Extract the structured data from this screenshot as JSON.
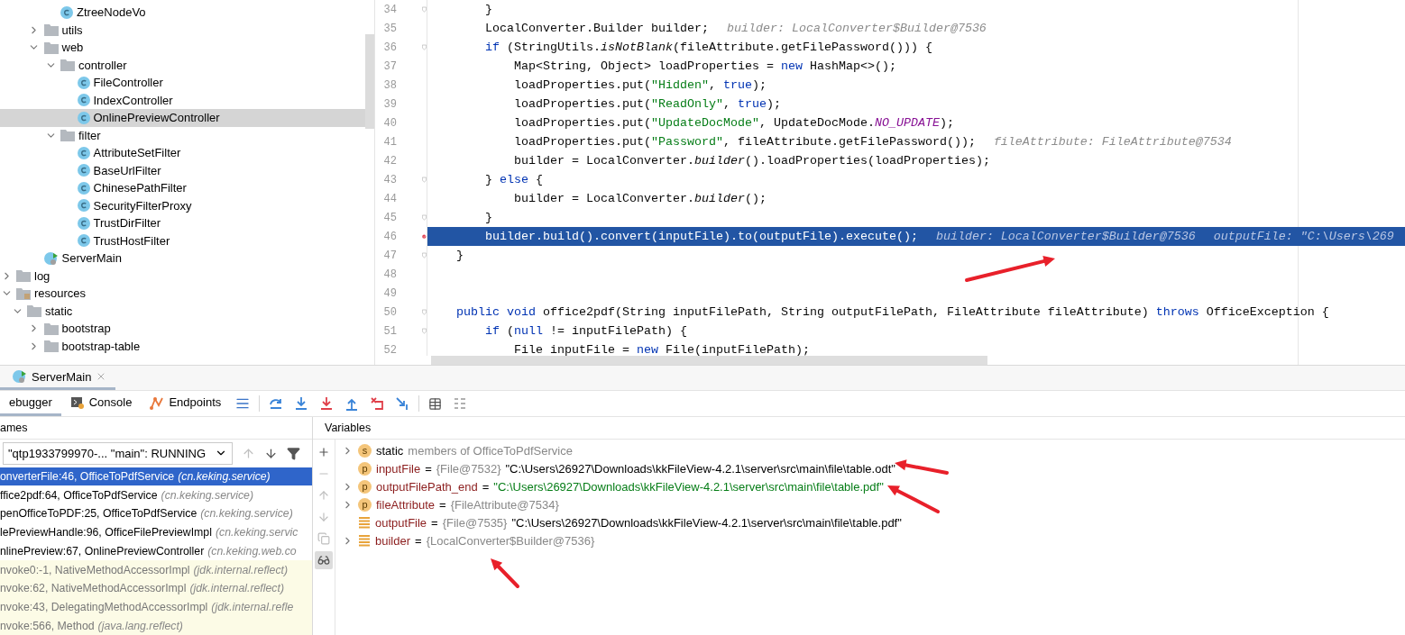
{
  "project_tree": {
    "items": [
      {
        "children": [
          {
            "children": [
              {
                "children": [
                  {
                    "label": "ZtreeNodeVo",
                    "kind": "class",
                    "selected": false
                  }
                ]
              },
              {
                "label": "utils",
                "kind": "folder",
                "expanded": false,
                "selected": false
              },
              {
                "label": "web",
                "kind": "folder",
                "expanded": true,
                "selected": false,
                "children": [
                  {
                    "label": "controller",
                    "kind": "folder",
                    "expanded": true,
                    "selected": false,
                    "children": [
                      {
                        "label": "FileController",
                        "kind": "class",
                        "selected": false
                      },
                      {
                        "label": "IndexController",
                        "kind": "class",
                        "selected": false
                      },
                      {
                        "label": "OnlinePreviewController",
                        "kind": "class",
                        "selected": true
                      }
                    ]
                  },
                  {
                    "label": "filter",
                    "kind": "folder",
                    "expanded": true,
                    "selected": false,
                    "children": [
                      {
                        "label": "AttributeSetFilter",
                        "kind": "class",
                        "selected": false
                      },
                      {
                        "label": "BaseUrlFilter",
                        "kind": "class",
                        "selected": false
                      },
                      {
                        "label": "ChinesePathFilter",
                        "kind": "class",
                        "selected": false
                      },
                      {
                        "label": "SecurityFilterProxy",
                        "kind": "class",
                        "selected": false
                      },
                      {
                        "label": "TrustDirFilter",
                        "kind": "class",
                        "selected": false
                      },
                      {
                        "label": "TrustHostFilter",
                        "kind": "class",
                        "selected": false
                      }
                    ]
                  }
                ]
              },
              {
                "label": "ServerMain",
                "kind": "main",
                "selected": false
              }
            ]
          }
        ]
      },
      {
        "label": "log",
        "kind": "folder",
        "expanded": false,
        "selected": false
      },
      {
        "label": "resources",
        "kind": "resources",
        "expanded": true,
        "selected": false,
        "children": [
          {
            "label": "static",
            "kind": "folder",
            "expanded": true,
            "selected": false,
            "children": [
              {
                "label": "bootstrap",
                "kind": "folder",
                "expanded": false,
                "selected": false
              },
              {
                "label": "bootstrap-table",
                "kind": "folder",
                "expanded": false,
                "selected": false
              }
            ]
          }
        ]
      }
    ]
  },
  "editor": {
    "lines": [
      {
        "number": "34",
        "fold": true,
        "breakpoint": false,
        "selected": false,
        "segments": [
          {
            "kind": "plain",
            "text": "        }"
          }
        ]
      },
      {
        "number": "35",
        "fold": false,
        "breakpoint": false,
        "selected": false,
        "segments": [
          {
            "kind": "plain",
            "text": "        LocalConverter.Builder builder;"
          },
          {
            "kind": "hint",
            "text": "builder: LocalConverter$Builder@7536"
          }
        ]
      },
      {
        "number": "36",
        "fold": true,
        "breakpoint": false,
        "selected": false,
        "segments": [
          {
            "kind": "keyword",
            "text": "        if"
          },
          {
            "kind": "plain",
            "text": " (StringUtils."
          },
          {
            "kind": "italic",
            "text": "isNotBlank"
          },
          {
            "kind": "plain",
            "text": "(fileAttribute.getFilePassword())) {"
          }
        ]
      },
      {
        "number": "37",
        "fold": false,
        "breakpoint": false,
        "selected": false,
        "segments": [
          {
            "kind": "plain",
            "text": "            Map<String, Object> loadProperties = "
          },
          {
            "kind": "keyword",
            "text": "new"
          },
          {
            "kind": "plain",
            "text": " HashMap<>();"
          }
        ]
      },
      {
        "number": "38",
        "fold": false,
        "breakpoint": false,
        "selected": false,
        "segments": [
          {
            "kind": "plain",
            "text": "            loadProperties.put("
          },
          {
            "kind": "string",
            "text": "\"Hidden\""
          },
          {
            "kind": "plain",
            "text": ", "
          },
          {
            "kind": "keyword",
            "text": "true"
          },
          {
            "kind": "plain",
            "text": ");"
          }
        ]
      },
      {
        "number": "39",
        "fold": false,
        "breakpoint": false,
        "selected": false,
        "segments": [
          {
            "kind": "plain",
            "text": "            loadProperties.put("
          },
          {
            "kind": "string",
            "text": "\"ReadOnly\""
          },
          {
            "kind": "plain",
            "text": ", "
          },
          {
            "kind": "keyword",
            "text": "true"
          },
          {
            "kind": "plain",
            "text": ");"
          }
        ]
      },
      {
        "number": "40",
        "fold": false,
        "breakpoint": false,
        "selected": false,
        "segments": [
          {
            "kind": "plain",
            "text": "            loadProperties.put("
          },
          {
            "kind": "string",
            "text": "\"UpdateDocMode\""
          },
          {
            "kind": "plain",
            "text": ", UpdateDocMode."
          },
          {
            "kind": "constant",
            "text": "NO_UPDATE"
          },
          {
            "kind": "plain",
            "text": ");"
          }
        ]
      },
      {
        "number": "41",
        "fold": false,
        "breakpoint": false,
        "selected": false,
        "segments": [
          {
            "kind": "plain",
            "text": "            loadProperties.put("
          },
          {
            "kind": "string",
            "text": "\"Password\""
          },
          {
            "kind": "plain",
            "text": ", fileAttribute.getFilePassword());"
          },
          {
            "kind": "hint",
            "text": "fileAttribute: FileAttribute@7534"
          }
        ]
      },
      {
        "number": "42",
        "fold": false,
        "breakpoint": false,
        "selected": false,
        "segments": [
          {
            "kind": "plain",
            "text": "            builder = LocalConverter."
          },
          {
            "kind": "italic",
            "text": "builder"
          },
          {
            "kind": "plain",
            "text": "().loadProperties(loadProperties);"
          }
        ]
      },
      {
        "number": "43",
        "fold": true,
        "breakpoint": false,
        "selected": false,
        "segments": [
          {
            "kind": "plain",
            "text": "        } "
          },
          {
            "kind": "keyword",
            "text": "else"
          },
          {
            "kind": "plain",
            "text": " {"
          }
        ]
      },
      {
        "number": "44",
        "fold": false,
        "breakpoint": false,
        "selected": false,
        "segments": [
          {
            "kind": "plain",
            "text": "            builder = LocalConverter."
          },
          {
            "kind": "italic",
            "text": "builder"
          },
          {
            "kind": "plain",
            "text": "();"
          }
        ]
      },
      {
        "number": "45",
        "fold": true,
        "breakpoint": false,
        "selected": false,
        "segments": [
          {
            "kind": "plain",
            "text": "        }"
          }
        ]
      },
      {
        "number": "46",
        "fold": false,
        "breakpoint": true,
        "selected": true,
        "segments": [
          {
            "kind": "plain",
            "text": "        builder.build().convert(inputFile).to(outputFile).execute();"
          },
          {
            "kind": "hint",
            "text": "builder: LocalConverter$Builder@7536"
          },
          {
            "kind": "hint",
            "text": "outputFile: \"C:\\Users\\269"
          }
        ]
      },
      {
        "number": "47",
        "fold": true,
        "breakpoint": false,
        "selected": false,
        "segments": [
          {
            "kind": "plain",
            "text": "    }"
          }
        ]
      },
      {
        "number": "48",
        "fold": false,
        "breakpoint": false,
        "selected": false
      },
      {
        "number": "49",
        "fold": false,
        "breakpoint": false,
        "selected": false
      },
      {
        "number": "50",
        "fold": true,
        "breakpoint": false,
        "selected": false,
        "segments": [
          {
            "kind": "keyword",
            "text": "    public void"
          },
          {
            "kind": "plain",
            "text": " office2pdf(String inputFilePath, String outputFilePath, FileAttribute fileAttribute) "
          },
          {
            "kind": "keyword",
            "text": "throws"
          },
          {
            "kind": "plain",
            "text": " OfficeException {"
          }
        ]
      },
      {
        "number": "51",
        "fold": true,
        "breakpoint": false,
        "selected": false,
        "segments": [
          {
            "kind": "keyword",
            "text": "        if"
          },
          {
            "kind": "plain",
            "text": " ("
          },
          {
            "kind": "keyword",
            "text": "null"
          },
          {
            "kind": "plain",
            "text": " != inputFilePath) {"
          }
        ]
      },
      {
        "number": "52",
        "fold": false,
        "breakpoint": false,
        "selected": false,
        "segments": [
          {
            "kind": "plain",
            "text": "            File inputFile = "
          },
          {
            "kind": "keyword",
            "text": "new"
          },
          {
            "kind": "plain",
            "text": " File(inputFilePath);"
          }
        ]
      }
    ]
  },
  "run_tab": {
    "label": "ServerMain",
    "selected": true
  },
  "debug_tabs": [
    {
      "label": "ebugger",
      "kind": "debugger",
      "selected": true
    },
    {
      "label": "Console",
      "kind": "console",
      "selected": false
    },
    {
      "label": "Endpoints",
      "kind": "endpoints",
      "selected": false
    }
  ],
  "frames": {
    "header": "ames",
    "thread": "\"qtp1933799970-... \"main\": RUNNING",
    "items": [
      {
        "method": "onverterFile:46, OfficeToPdfService",
        "package": "(cn.keking.service)",
        "kind": "project",
        "selected": true
      },
      {
        "method": "ffice2pdf:64, OfficeToPdfService",
        "package": "(cn.keking.service)",
        "kind": "project",
        "selected": false
      },
      {
        "method": "penOfficeToPDF:25, OfficeToPdfService",
        "package": "(cn.keking.service)",
        "kind": "project",
        "selected": false
      },
      {
        "method": "lePreviewHandle:96, OfficeFilePreviewImpl",
        "package": "(cn.keking.servic",
        "kind": "project",
        "selected": false
      },
      {
        "method": "nlinePreview:67, OnlinePreviewController",
        "package": "(cn.keking.web.co",
        "kind": "project",
        "selected": false
      },
      {
        "method": "nvoke0:-1, NativeMethodAccessorImpl",
        "package": "(jdk.internal.reflect)",
        "kind": "library",
        "selected": false
      },
      {
        "method": "nvoke:62, NativeMethodAccessorImpl",
        "package": "(jdk.internal.reflect)",
        "kind": "library",
        "selected": false
      },
      {
        "method": "nvoke:43, DelegatingMethodAccessorImpl",
        "package": "(jdk.internal.refle",
        "kind": "library",
        "selected": false
      },
      {
        "method": "nvoke:566, Method",
        "package": "(java.lang.reflect)",
        "kind": "library",
        "selected": false
      }
    ]
  },
  "side_tools": [
    {
      "kind": "add",
      "disabled": false,
      "selected": false
    },
    {
      "kind": "remove",
      "disabled": true,
      "selected": false
    },
    {
      "kind": "up",
      "disabled": true,
      "selected": false
    },
    {
      "kind": "down",
      "disabled": true,
      "selected": false
    },
    {
      "kind": "copy",
      "disabled": true,
      "selected": false
    },
    {
      "kind": "watches",
      "disabled": false,
      "selected": true
    }
  ],
  "variables": {
    "header": "Variables",
    "items": [
      {
        "kind": "static",
        "expandable": true,
        "badge": "s",
        "name": "static",
        "description": "members of OfficeToPdfService"
      },
      {
        "kind": "param",
        "expandable": false,
        "badge": "p",
        "name": "inputFile",
        "equals": "=",
        "type": "{File@7532}",
        "value": "\"C:\\Users\\26927\\Downloads\\kkFileView-4.2.1\\server\\src\\main\\file\\table.odt\"",
        "string_value": false
      },
      {
        "kind": "param",
        "expandable": true,
        "badge": "p",
        "name": "outputFilePath_end",
        "equals": "=",
        "value": "\"C:\\Users\\26927\\Downloads\\kkFileView-4.2.1\\server\\src\\main\\file\\table.pdf\"",
        "string_value": true
      },
      {
        "kind": "param",
        "expandable": true,
        "badge": "p",
        "name": "fileAttribute",
        "equals": "=",
        "type": "{FileAttribute@7534}"
      },
      {
        "kind": "local",
        "expandable": false,
        "name": "outputFile",
        "equals": "=",
        "type": "{File@7535}",
        "value": "\"C:\\Users\\26927\\Downloads\\kkFileView-4.2.1\\server\\src\\main\\file\\table.pdf\"",
        "string_value": false
      },
      {
        "kind": "local",
        "expandable": true,
        "name": "builder",
        "equals": "=",
        "type": "{LocalConverter$Builder@7536}"
      }
    ]
  }
}
